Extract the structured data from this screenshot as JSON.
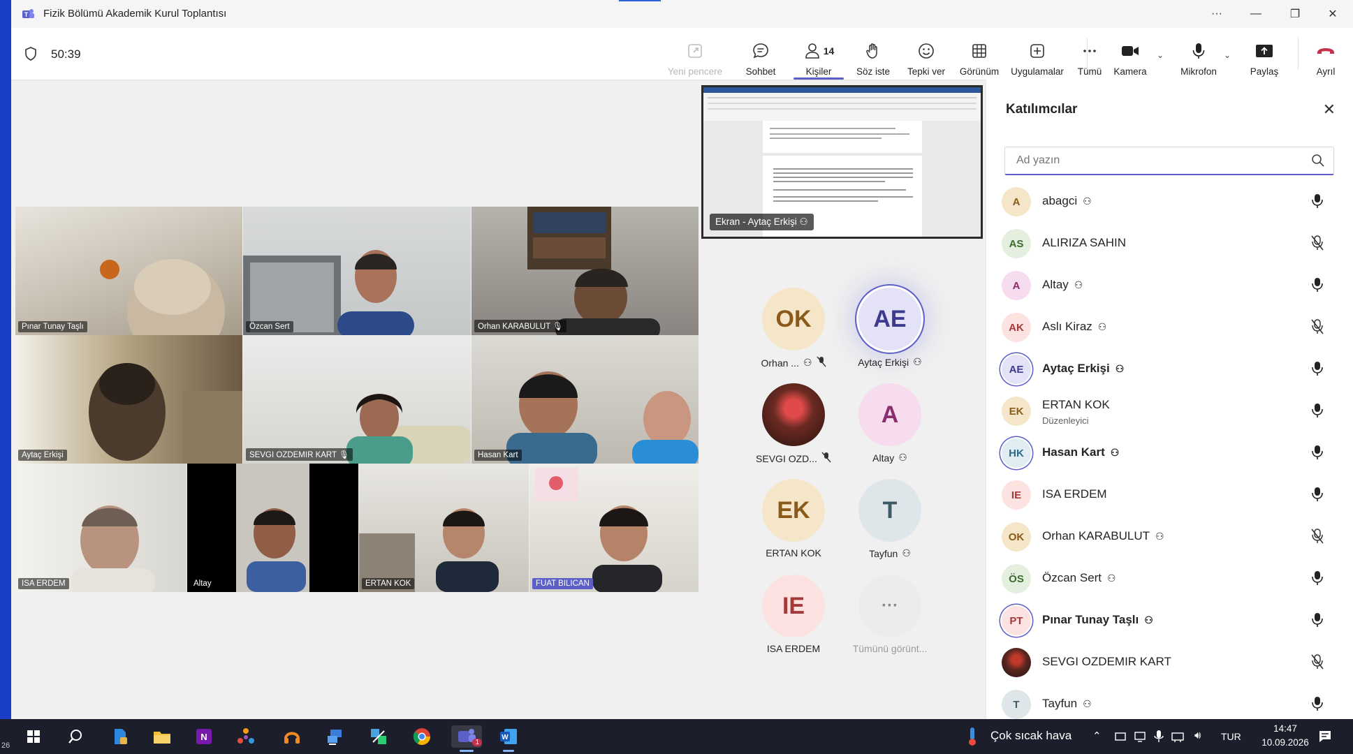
{
  "window": {
    "title": "Fizik Bölümü Akademik Kurul Toplantısı"
  },
  "meeting": {
    "timer": "50:39",
    "toolbar": {
      "yeni_pencere": "Yeni pencere",
      "sohbet": "Sohbet",
      "kisiler": "Kişiler",
      "people_count": "14",
      "soz_iste": "Söz iste",
      "tepki_ver": "Tepki ver",
      "gorunum": "Görünüm",
      "uygulamalar": "Uygulamalar",
      "tumu": "Tümü",
      "kamera": "Kamera",
      "mikrofon": "Mikrofon",
      "paylas": "Paylaş",
      "ayril": "Ayrıl"
    }
  },
  "videos": [
    {
      "name": "Pınar Tunay Taşlı"
    },
    {
      "name": "Özcan Sert"
    },
    {
      "name": "Orhan KARABULUT"
    },
    {
      "name": "Aytaç Erkişi"
    },
    {
      "name": "SEVGI OZDEMIR KART"
    },
    {
      "name": "Hasan Kart"
    },
    {
      "name": "ISA ERDEM"
    },
    {
      "name": "Altay"
    },
    {
      "name": "ERTAN KOK"
    },
    {
      "name": "FUAT BILICAN"
    }
  ],
  "shared_screen": {
    "label": "Ekran - Aytaç Erkişi"
  },
  "gallery": [
    {
      "initials": "OK",
      "name": "Orhan ...",
      "bg": "#f6e6c9",
      "fg": "#8a5a1a"
    },
    {
      "initials": "AE",
      "name": "Aytaç Erkişi",
      "bg": "#e3e2f6",
      "fg": "#3b3a8f"
    },
    {
      "initials": "",
      "name": "SEVGI OZD...",
      "bg": "#3a1e1a",
      "fg": "#fff"
    },
    {
      "initials": "A",
      "name": "Altay",
      "bg": "#f6dcee",
      "fg": "#8a2f6e"
    },
    {
      "initials": "EK",
      "name": "ERTAN KOK",
      "bg": "#f6e6c9",
      "fg": "#8a5a1a"
    },
    {
      "initials": "T",
      "name": "Tayfun",
      "bg": "#dfe6ea",
      "fg": "#3d5a66"
    },
    {
      "initials": "IE",
      "name": "ISA ERDEM",
      "bg": "#fde2e2",
      "fg": "#a23a3a"
    },
    {
      "initials": "···",
      "name": "Tümünü görünt...",
      "bg": "#ececec",
      "fg": "#8a8a8a"
    }
  ],
  "panel": {
    "title": "Katılımcılar",
    "search_placeholder": "Ad yazın",
    "participants": [
      {
        "initials": "A",
        "name": "abagci",
        "role": "",
        "bg": "#f6e6c9",
        "fg": "#8a5a1a",
        "mic": "on",
        "bold": false
      },
      {
        "initials": "AS",
        "name": "ALIRIZA SAHIN",
        "role": "",
        "bg": "#e4efe0",
        "fg": "#3d6b2e",
        "mic": "off",
        "bold": false
      },
      {
        "initials": "A",
        "name": "Altay",
        "role": "",
        "bg": "#f6dcee",
        "fg": "#8a2f6e",
        "mic": "on",
        "bold": false
      },
      {
        "initials": "AK",
        "name": "Aslı Kiraz",
        "role": "",
        "bg": "#fde2e2",
        "fg": "#a23a3a",
        "mic": "off",
        "bold": false
      },
      {
        "initials": "AE",
        "name": "Aytaç Erkişi",
        "role": "",
        "bg": "#e3e2f6",
        "fg": "#3b3a8f",
        "mic": "on",
        "bold": true
      },
      {
        "initials": "EK",
        "name": "ERTAN KOK",
        "role": "Düzenleyici",
        "bg": "#f6e6c9",
        "fg": "#8a5a1a",
        "mic": "on",
        "bold": false
      },
      {
        "initials": "HK",
        "name": "Hasan Kart",
        "role": "",
        "bg": "#e0eef4",
        "fg": "#2d6a86",
        "mic": "on",
        "bold": true
      },
      {
        "initials": "IE",
        "name": "ISA ERDEM",
        "role": "",
        "bg": "#fde2e2",
        "fg": "#a23a3a",
        "mic": "on",
        "bold": false
      },
      {
        "initials": "OK",
        "name": "Orhan KARABULUT",
        "role": "",
        "bg": "#f6e6c9",
        "fg": "#8a5a1a",
        "mic": "off",
        "bold": false
      },
      {
        "initials": "ÖS",
        "name": "Özcan Sert",
        "role": "",
        "bg": "#e4efe0",
        "fg": "#3d6b2e",
        "mic": "on",
        "bold": false
      },
      {
        "initials": "PT",
        "name": "Pınar Tunay Taşlı",
        "role": "",
        "bg": "#fde2e2",
        "fg": "#a23a3a",
        "mic": "on",
        "bold": true
      },
      {
        "initials": "",
        "name": "SEVGI OZDEMIR KART",
        "role": "",
        "bg": "#3a1e1a",
        "fg": "#fff",
        "mic": "off",
        "bold": false
      },
      {
        "initials": "T",
        "name": "Tayfun",
        "role": "",
        "bg": "#dfe6ea",
        "fg": "#3d5a66",
        "mic": "on",
        "bold": false
      }
    ]
  },
  "taskbar": {
    "weather": "Çok sıcak hava",
    "language": "TUR",
    "time": "14:47",
    "date": "10.09.2026",
    "left_edge": "26",
    "teams_badge": "1"
  }
}
